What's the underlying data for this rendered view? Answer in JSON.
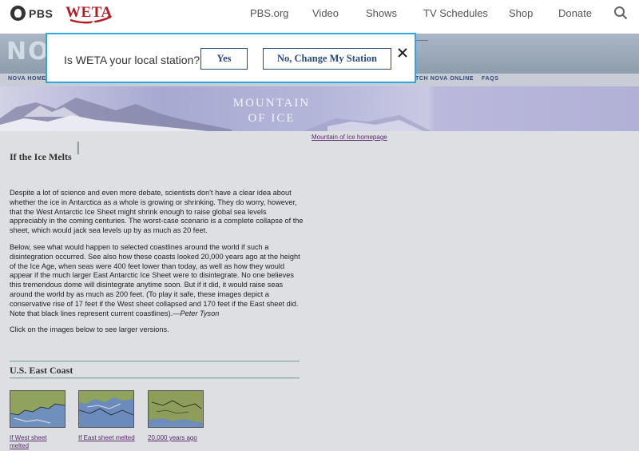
{
  "top_nav": {
    "pbs_logo": "PBS",
    "station_logo": "WETA",
    "links": [
      "PBS.org",
      "Video",
      "Shows",
      "TV Schedules",
      "Shop",
      "Donate"
    ],
    "search_icon": "search-icon"
  },
  "station_dialog": {
    "question": "Is WETA your local station?",
    "yes_label": "Yes",
    "change_label": "No, Change My Station",
    "close_icon": "close-icon"
  },
  "nova": {
    "logo": "NOVA",
    "nav_left": "NOVA HOME",
    "nav_right": [
      "TCH NOVA ONLINE",
      "FAQS"
    ]
  },
  "banner": {
    "line1": "MOUNTAIN",
    "line2": "OF ICE"
  },
  "content": {
    "home_link": "Mountain of Ice homepage",
    "title": "If the Ice Melts",
    "para1": "Despite a lot of science and even more debate, scientists don't have a clear idea about whether the ice in Antarctica as a whole is growing or shrinking. They do worry, however, that the West Antarctic Ice Sheet might shrink enough to raise global sea levels appreciably in the coming centuries. The worst-case scenario is a complete collapse of the sheet, which would jack sea levels up by as much as 20 feet.",
    "para2": "Below, see what would happen to selected coastlines around the world if such a disintegration occurred. See also how these coasts looked 20,000 years ago at the height of the Ice Age, when seas were 400 feet lower than today, as well as how they would appear if the much larger East Antarctic Ice Sheet were to disintegrate. No one believes this tremendous dome will disintegrate anytime soon. But if it did, it would raise seas around the world by as much as 200 feet. (To play it safe, these images depict a conservative rise of 17 feet if the West sheet collapsed and 170 feet if the East sheet did. Note that black lines represent current coastlines).—",
    "author": "Peter Tyson",
    "para3": "Click on the images below to see larger versions.",
    "section_title": "U.S. East Coast",
    "thumbs": [
      {
        "caption": "If West sheet melted"
      },
      {
        "caption": "If East sheet melted"
      },
      {
        "caption": "20,000 years ago"
      }
    ]
  }
}
